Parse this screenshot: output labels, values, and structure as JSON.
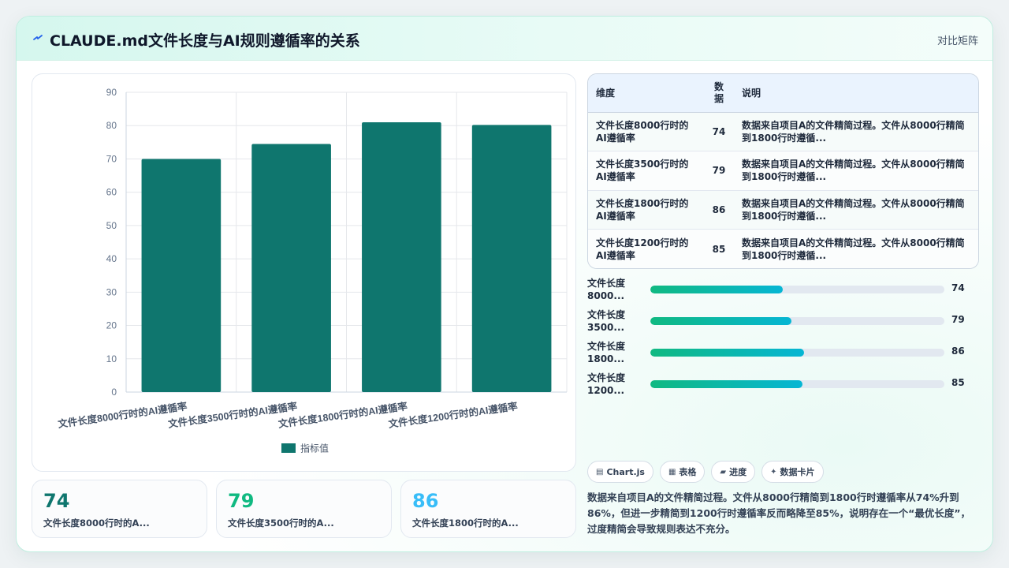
{
  "header": {
    "title": "CLAUDE.md文件长度与AI规则遵循率的关系",
    "link_label": "对比矩阵",
    "icon": "lightning-icon"
  },
  "chart_data": {
    "type": "bar",
    "categories": [
      "文件长度8000行时的AI遵循率",
      "文件长度3500行时的AI遵循率",
      "文件长度1800行时的AI遵循率",
      "文件长度1200行时的AI遵循率"
    ],
    "series": [
      {
        "name": "指标值",
        "values": [
          70,
          74.5,
          81,
          80.2
        ],
        "color": "#0f766e"
      }
    ],
    "ylim": [
      0,
      90
    ],
    "yticks": [
      "0",
      "10",
      "20",
      "30",
      "40",
      "50",
      "60",
      "70",
      "80",
      "90"
    ],
    "grid": true,
    "legend": "bottom"
  },
  "table": {
    "headers": [
      "维度",
      "数据",
      "说明"
    ],
    "rows": [
      [
        "文件长度8000行时的AI遵循率",
        "74",
        "数据来自项目A的文件精简过程。文件从8000行精简到1800行时遵循..."
      ],
      [
        "文件长度3500行时的AI遵循率",
        "79",
        "数据来自项目A的文件精简过程。文件从8000行精简到1800行时遵循..."
      ],
      [
        "文件长度1800行时的AI遵循率",
        "86",
        "数据来自项目A的文件精简过程。文件从8000行精简到1800行时遵循..."
      ],
      [
        "文件长度1200行时的AI遵循率",
        "85",
        "数据来自项目A的文件精简过程。文件从8000行精简到1800行时遵循..."
      ]
    ]
  },
  "progress": [
    {
      "label": "文件长度 8000...",
      "value": "74",
      "fraction": 0.45
    },
    {
      "label": "文件长度 3500...",
      "value": "79",
      "fraction": 0.48
    },
    {
      "label": "文件长度 1800...",
      "value": "86",
      "fraction": 0.523
    },
    {
      "label": "文件长度 1200...",
      "value": "85",
      "fraction": 0.517
    }
  ],
  "tags": [
    {
      "icon": "chart-icon",
      "label": "Chart.js"
    },
    {
      "icon": "table-icon",
      "label": "表格"
    },
    {
      "icon": "progress-icon",
      "label": "进度"
    },
    {
      "icon": "sparkle-icon",
      "label": "数据卡片"
    }
  ],
  "summary": "数据来自项目A的文件精简过程。文件从8000行精简到1800行时遵循率从74%升到86%，但进一步精简到1200行时遵循率反而略降至85%，说明存在一个“最优长度”，过度精简会导致规则表达不充分。",
  "stats": [
    {
      "value": "74",
      "label": "文件长度8000行时的A...",
      "color": "#0f766e"
    },
    {
      "value": "79",
      "label": "文件长度3500行时的A...",
      "color": "#10b981"
    },
    {
      "value": "86",
      "label": "文件长度1800行时的A...",
      "color": "#38bdf8"
    }
  ]
}
